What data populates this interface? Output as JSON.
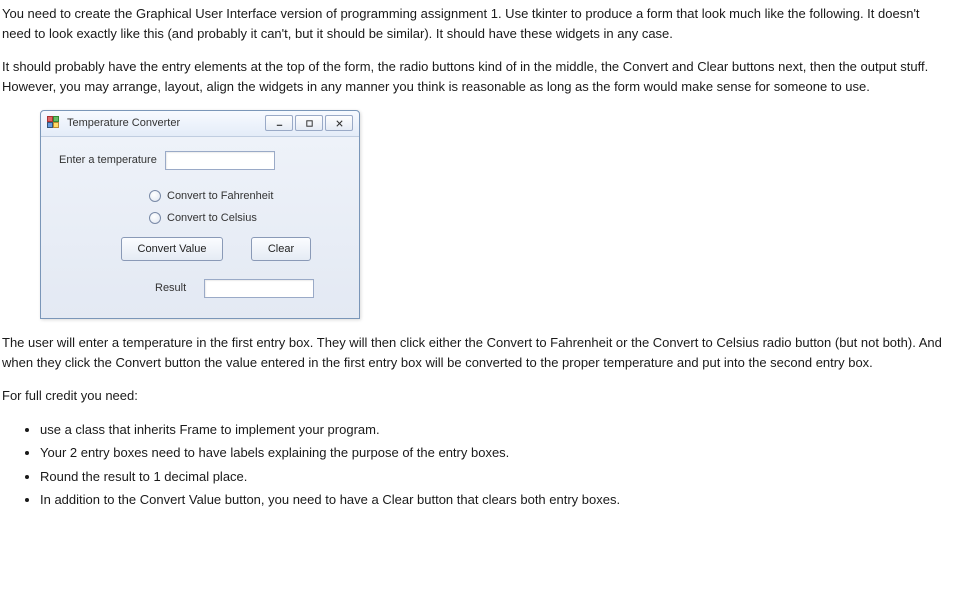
{
  "paragraphs": {
    "p1": "You need to create the Graphical User Interface version of programming assignment 1. Use tkinter to produce a form that look much like the following. It doesn't need to look exactly like this (and probably it can't, but it should be similar). It should have these widgets in any case.",
    "p2": "It should probably have the entry elements at the top of the form, the radio buttons kind of in the middle, the Convert and Clear buttons next, then the output stuff. However, you may arrange, layout, align the widgets in any manner you think is reasonable as long as the form would make sense for someone to use.",
    "p3": "The user will enter a temperature in the first entry box. They will then click either the Convert to Fahrenheit or the Convert to Celsius radio button (but not both). And when they click the Convert button the value entered in the first entry box will be converted to the proper temperature and put into the second entry box.",
    "credit_heading": "For full credit you need:"
  },
  "credit_items": [
    "use a class that inherits Frame to implement your program.",
    "Your 2 entry boxes need to have labels explaining the purpose of the entry boxes.",
    "Round the result to 1 decimal place.",
    "In addition to the Convert Value button, you need to have a Clear button that clears both entry boxes."
  ],
  "app": {
    "title": "Temperature Converter",
    "enter_label": "Enter a temperature",
    "radio_fahrenheit": "Convert to Fahrenheit",
    "radio_celsius": "Convert to Celsius",
    "convert_button": "Convert Value",
    "clear_button": "Clear",
    "result_label": "Result"
  }
}
